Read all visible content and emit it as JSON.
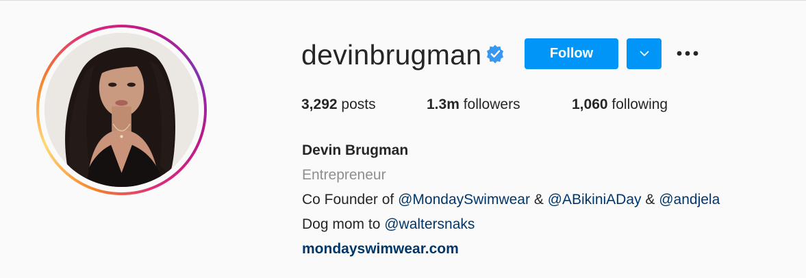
{
  "profile": {
    "username": "devinbrugman",
    "verified": true,
    "follow_label": "Follow",
    "stats": {
      "posts_count": "3,292",
      "posts_label": " posts",
      "followers_count": "1.3m",
      "followers_label": " followers",
      "following_count": "1,060",
      "following_label": " following"
    },
    "bio": {
      "full_name": "Devin Brugman",
      "category": "Entrepreneur",
      "line1_prefix": "Co Founder of ",
      "mention1": "@MondaySwimwear",
      "sep1": " & ",
      "mention2": "@ABikiniADay",
      "sep2": " & ",
      "mention3": "@andjela",
      "line2_prefix": "Dog mom to ",
      "mention4": "@waltersnaks",
      "website": "mondayswimwear.com"
    }
  },
  "icons": {
    "verified": "verified-badge-icon",
    "dropdown": "chevron-down-icon",
    "more": "more-options-icon"
  },
  "colors": {
    "accent": "#0095f6",
    "link": "#00376b",
    "secondary_text": "#8e8e8e",
    "verified": "#3897f0"
  }
}
